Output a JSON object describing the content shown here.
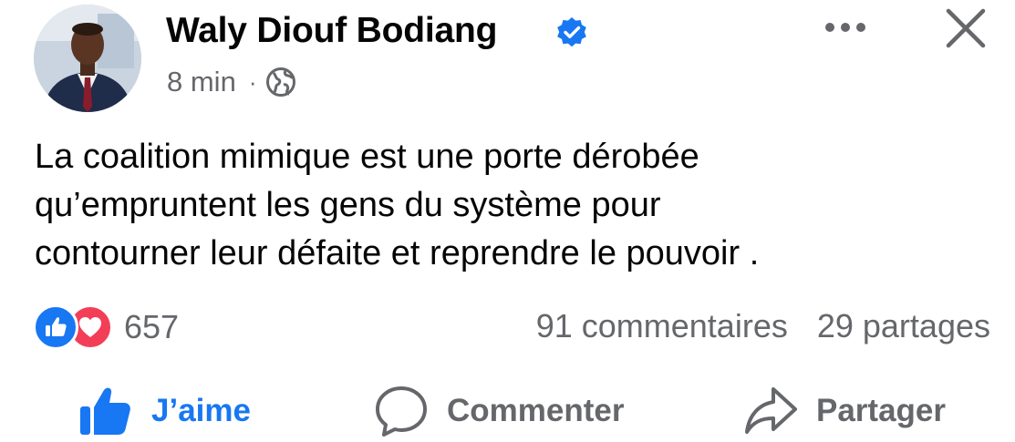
{
  "post": {
    "author": "Waly Diouf Bodiang",
    "verified": true,
    "timestamp": "8 min",
    "separator": "·",
    "audience_icon": "globe-icon",
    "text_lines": [
      "La coalition mimique est une porte dérobée",
      "qu’empruntent les gens du système pour",
      "contourner leur défaite et reprendre le pouvoir ."
    ]
  },
  "stats": {
    "reaction_icons": [
      "like-icon",
      "love-icon"
    ],
    "reactions": "657",
    "comments": "91 commentaires",
    "shares": "29 partages"
  },
  "actions": {
    "like": "J’aime",
    "comment": "Commenter",
    "share": "Partager"
  },
  "colors": {
    "accent": "#1877f2",
    "love": "#f33e58",
    "secondary_text": "#65676b",
    "primary_text": "#050505"
  }
}
